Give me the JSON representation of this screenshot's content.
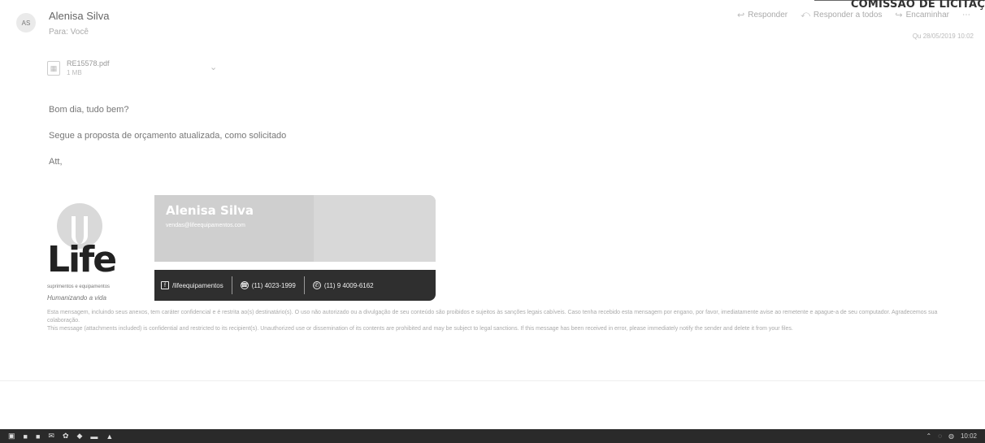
{
  "stamp": {
    "text": "COMISSÃO DE LICITAÇ"
  },
  "email": {
    "avatar_initials": "AS",
    "sender": "Alenisa Silva",
    "to": "Para: Você",
    "date": "Qu 28/05/2019 10:02",
    "actions": [
      {
        "label": "Responder",
        "icon": "reply-icon"
      },
      {
        "label": "Responder a todos",
        "icon": "reply-all-icon"
      },
      {
        "label": "Encaminhar",
        "icon": "forward-icon"
      }
    ]
  },
  "attachment": {
    "name": "RE15578.pdf",
    "size": "1 MB"
  },
  "body": {
    "greeting": "Bom dia, tudo bem?",
    "line": "Segue a proposta de orçamento atualizada, como solicitado",
    "closing": "Att,"
  },
  "signature": {
    "brand": "Life",
    "tagline": "suprimentos e equipamentos",
    "script": "Humanizando a vida",
    "name": "Alenisa Silva",
    "email": "vendas@lifeequipamentos.com",
    "facebook": "/lifeequipamentos",
    "phone": "(11) 4023-1999",
    "whatsapp": "(11) 9 4009-6162"
  },
  "disclaimer": {
    "pt": "Esta mensagem, incluindo seus anexos, tem caráter confidencial e é restrita ao(s) destinatário(s). O uso não autorizado ou a divulgação de seu conteúdo são proibidos e sujeitos às sanções legais cabíveis. Caso tenha recebido esta mensagem por engano, por favor, imediatamente avise ao remetente e apague-a de seu computador. Agradecemos sua colaboração.",
    "en": "This message (attachments included) is confidential and restricted to its recipient(s). Unauthorized use or dissemination of its contents are prohibited and may be subject to legal sanctions. If this message has been received in error, please immediately notify the sender and delete it from your files."
  },
  "taskbar": {
    "time": "10:02"
  }
}
